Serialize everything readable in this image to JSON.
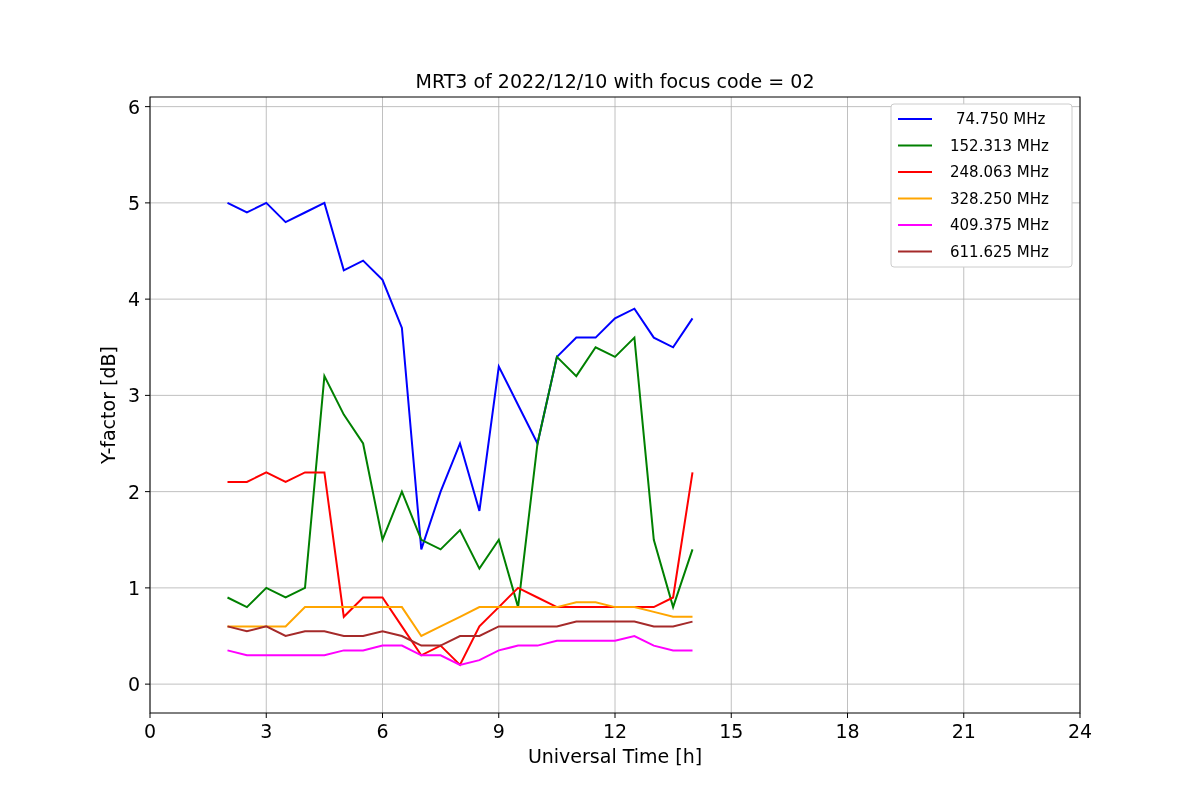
{
  "chart_data": {
    "type": "line",
    "title": "MRT3 of 2022/12/10 with focus code = 02",
    "xlabel": "Universal Time [h]",
    "ylabel": "Y-factor [dB]",
    "x": [
      2,
      2.5,
      3,
      3.5,
      4,
      4.5,
      5,
      5.5,
      6,
      6.5,
      7,
      7.5,
      8,
      8.5,
      9,
      9.5,
      10,
      10.5,
      11,
      11.5,
      12,
      12.5,
      13,
      13.5,
      14
    ],
    "series": [
      {
        "name": "74.750 MHz",
        "color": "#0000ff",
        "values": [
          5.0,
          4.9,
          5.0,
          4.8,
          4.9,
          5.0,
          4.3,
          4.4,
          4.2,
          3.7,
          1.4,
          2.0,
          2.5,
          1.8,
          3.3,
          2.9,
          2.5,
          3.4,
          3.6,
          3.6,
          3.8,
          3.9,
          3.6,
          3.5,
          3.8
        ]
      },
      {
        "name": "152.313 MHz",
        "color": "#008000",
        "values": [
          0.9,
          0.8,
          1.0,
          0.9,
          1.0,
          3.2,
          2.8,
          2.5,
          1.5,
          2.0,
          1.5,
          1.4,
          1.6,
          1.2,
          1.5,
          0.8,
          2.5,
          3.4,
          3.2,
          3.5,
          3.4,
          3.6,
          1.5,
          0.8,
          1.4
        ]
      },
      {
        "name": "248.063 MHz",
        "color": "#ff0000",
        "values": [
          2.1,
          2.1,
          2.2,
          2.1,
          2.2,
          2.2,
          0.7,
          0.9,
          0.9,
          0.6,
          0.3,
          0.4,
          0.2,
          0.6,
          0.8,
          1.0,
          0.9,
          0.8,
          0.8,
          0.8,
          0.8,
          0.8,
          0.8,
          0.9,
          2.2
        ]
      },
      {
        "name": "328.250 MHz",
        "color": "#ffa500",
        "values": [
          0.6,
          0.6,
          0.6,
          0.6,
          0.8,
          0.8,
          0.8,
          0.8,
          0.8,
          0.8,
          0.5,
          0.6,
          0.7,
          0.8,
          0.8,
          0.8,
          0.8,
          0.8,
          0.85,
          0.85,
          0.8,
          0.8,
          0.75,
          0.7,
          0.7
        ]
      },
      {
        "name": "409.375 MHz",
        "color": "#ff00ff",
        "values": [
          0.35,
          0.3,
          0.3,
          0.3,
          0.3,
          0.3,
          0.35,
          0.35,
          0.4,
          0.4,
          0.3,
          0.3,
          0.2,
          0.25,
          0.35,
          0.4,
          0.4,
          0.45,
          0.45,
          0.45,
          0.45,
          0.5,
          0.4,
          0.35,
          0.35
        ]
      },
      {
        "name": "611.625 MHz",
        "color": "#a52a2a",
        "values": [
          0.6,
          0.55,
          0.6,
          0.5,
          0.55,
          0.55,
          0.5,
          0.5,
          0.55,
          0.5,
          0.4,
          0.4,
          0.5,
          0.5,
          0.6,
          0.6,
          0.6,
          0.6,
          0.65,
          0.65,
          0.65,
          0.65,
          0.6,
          0.6,
          0.65
        ]
      }
    ],
    "xlim": [
      0,
      24
    ],
    "ylim": [
      -0.3,
      6.1
    ],
    "xticks": [
      0,
      3,
      6,
      9,
      12,
      15,
      18,
      21,
      24
    ],
    "yticks": [
      0,
      1,
      2,
      3,
      4,
      5,
      6
    ],
    "grid": true,
    "legend": "upper right"
  }
}
